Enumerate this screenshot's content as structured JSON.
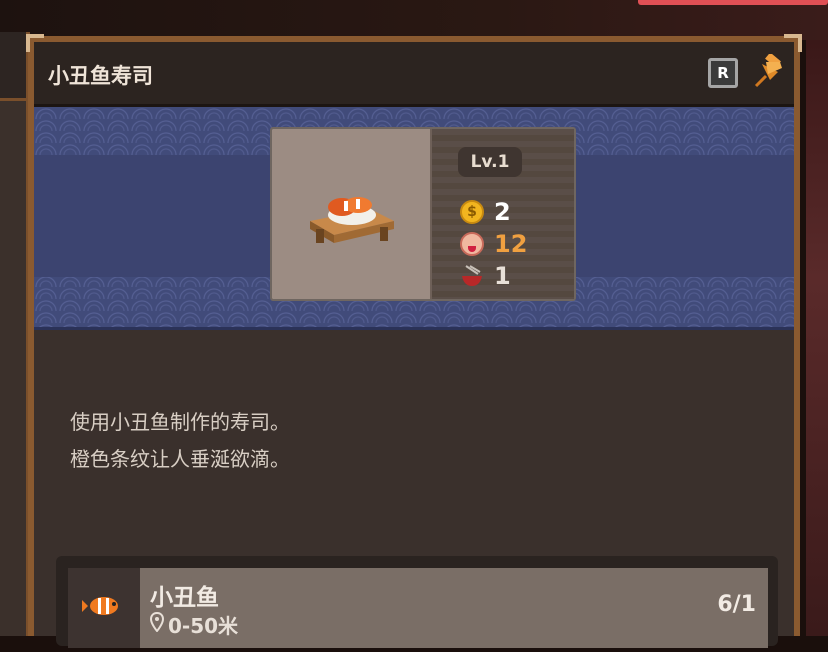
{
  "panel": {
    "title": "小丑鱼寿司",
    "hotkey_label": "R"
  },
  "item": {
    "level": "Lv.1",
    "price": "2",
    "taste": "12",
    "servings": "1"
  },
  "description": {
    "line1": "使用小丑鱼制作的寿司。",
    "line2": "橙色条纹让人垂涎欲滴。"
  },
  "ingredient": {
    "name": "小丑鱼",
    "location": "0-50米",
    "count": "6/1"
  },
  "colors": {
    "accent_orange": "#f0a040",
    "banner_blue": "#414b7a",
    "panel_border": "#8a5a30",
    "coin_gold": "#f2b51f"
  },
  "icons": {
    "pin": "pin-icon",
    "coin": "coin-icon",
    "taste": "taste-icon",
    "bowl": "bowl-icon",
    "location": "location-pin-icon",
    "fish": "clownfish-icon",
    "sushi": "clownfish-sushi-icon"
  }
}
